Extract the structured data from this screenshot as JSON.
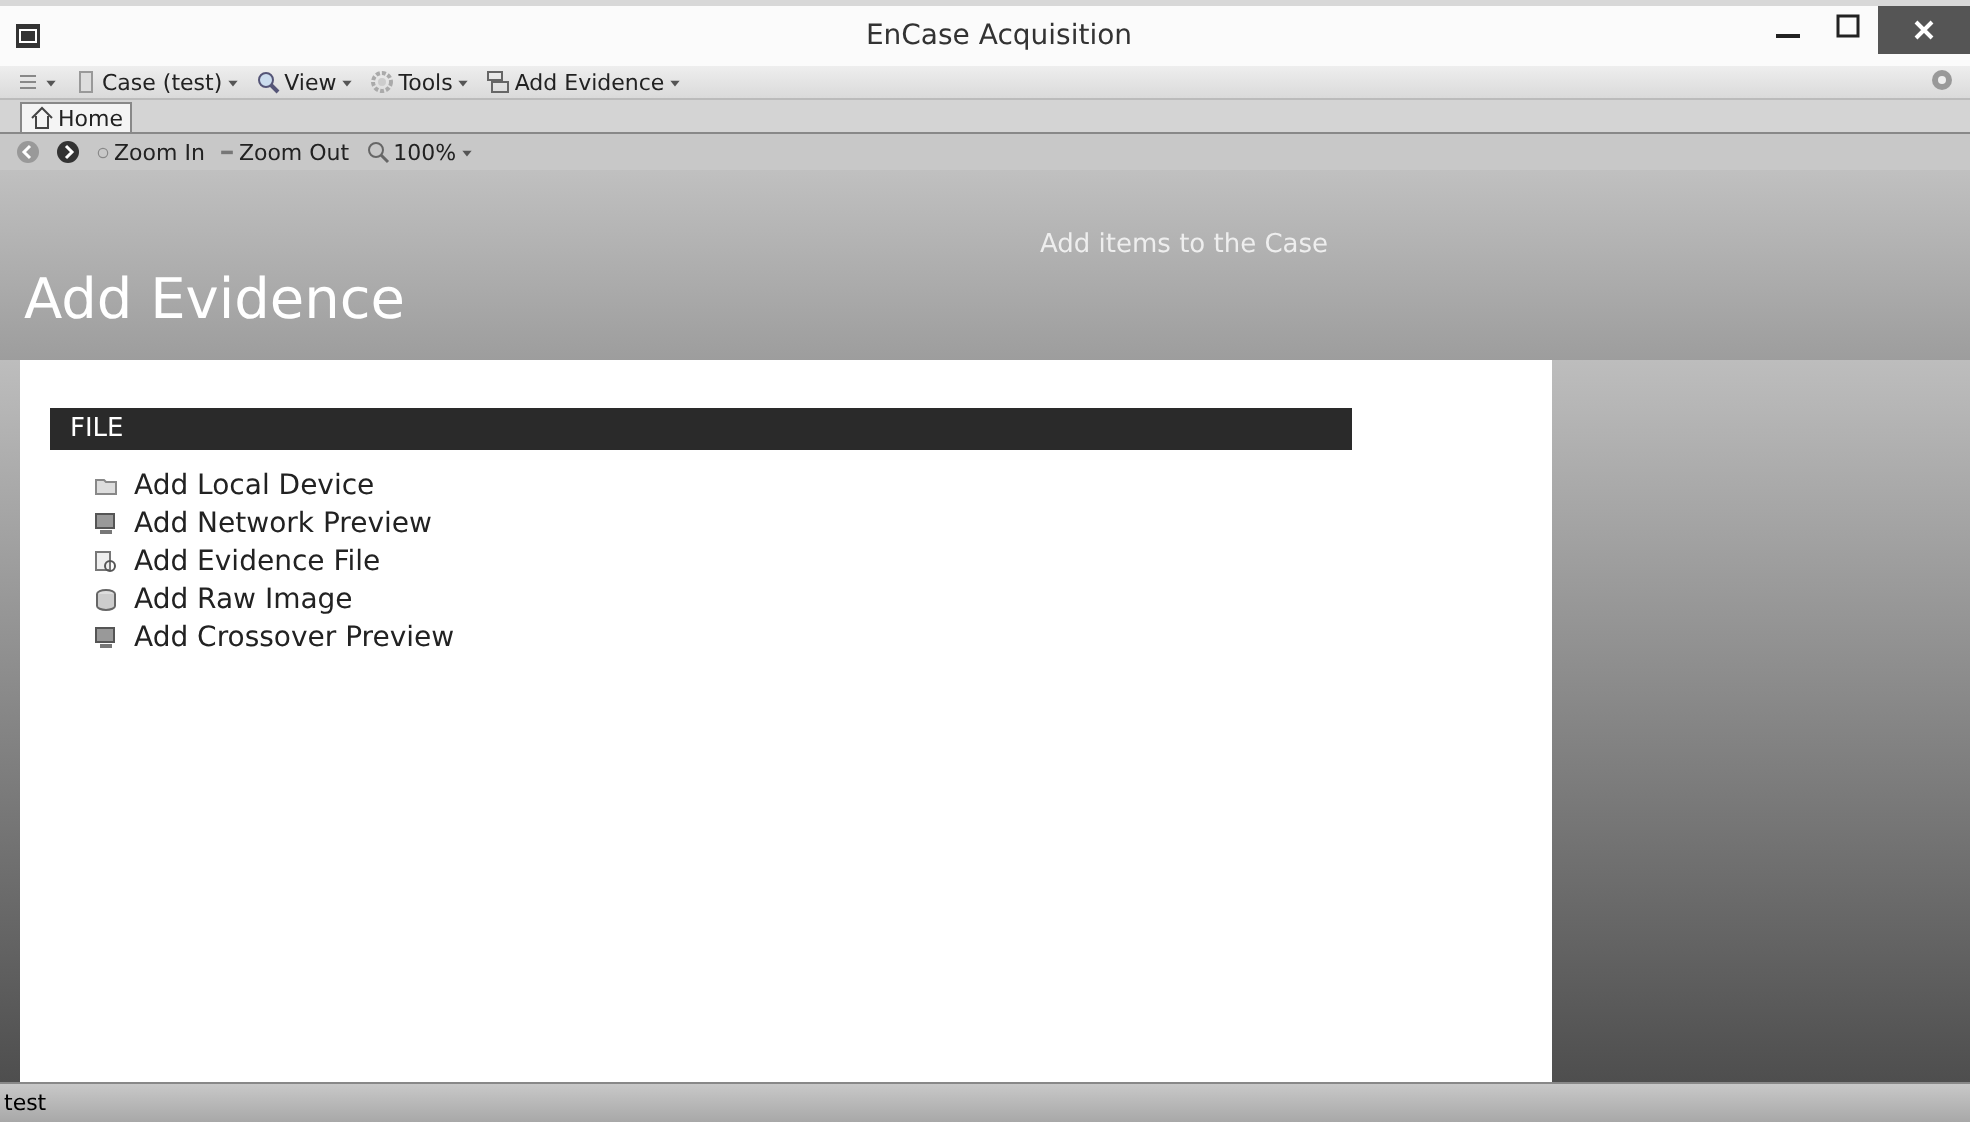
{
  "window": {
    "title": "EnCase Acquisition"
  },
  "toolbar": [
    {
      "label": "Case (test)"
    },
    {
      "label": "View"
    },
    {
      "label": "Tools"
    },
    {
      "label": "Add Evidence"
    }
  ],
  "tabs": [
    {
      "label": "Home",
      "selected": true
    }
  ],
  "nav": {
    "zoom_in": "Zoom In",
    "zoom_out": "Zoom Out",
    "zoom_level": "100%"
  },
  "header": {
    "title": "Add Evidence",
    "subtitle": "Add items to the Case"
  },
  "section": {
    "title": "FILE",
    "items": [
      {
        "label": "Add Local Device"
      },
      {
        "label": "Add Network Preview"
      },
      {
        "label": "Add Evidence File"
      },
      {
        "label": "Add Raw Image"
      },
      {
        "label": "Add Crossover Preview"
      }
    ]
  },
  "status_bar": "test"
}
